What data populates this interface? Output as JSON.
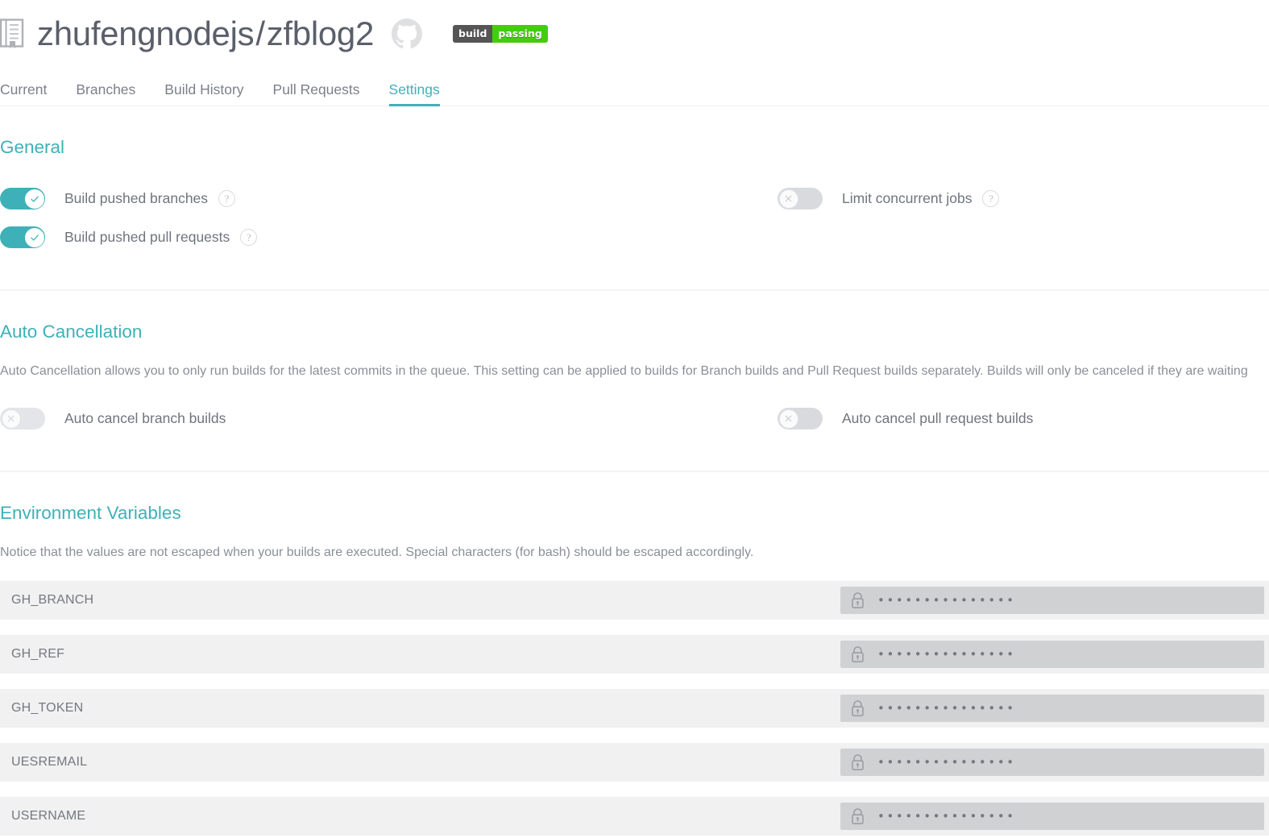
{
  "header": {
    "repo_icon": "book-icon",
    "owner": "zhufengnodejs",
    "separator": "/",
    "repo": "zfblog2",
    "github_icon": "github-icon",
    "badge": {
      "label": "build",
      "status": "passing",
      "label_color": "#555555",
      "status_color": "#44cc11"
    }
  },
  "tabs": [
    {
      "label": "Current",
      "active": false
    },
    {
      "label": "Branches",
      "active": false
    },
    {
      "label": "Build History",
      "active": false
    },
    {
      "label": "Pull Requests",
      "active": false
    },
    {
      "label": "Settings",
      "active": true
    }
  ],
  "accent_color": "#3eb1b8",
  "general": {
    "title": "General",
    "settings": [
      {
        "label": "Build pushed branches",
        "state": "on",
        "help": "?",
        "column": "left"
      },
      {
        "label": "Limit concurrent jobs",
        "state": "off",
        "help": "?",
        "column": "right"
      },
      {
        "label": "Build pushed pull requests",
        "state": "on",
        "help": "?",
        "column": "left"
      }
    ]
  },
  "auto_cancellation": {
    "title": "Auto Cancellation",
    "description": "Auto Cancellation allows you to only run builds for the latest commits in the queue. This setting can be applied to builds for Branch builds and Pull Request builds separately. Builds will only be canceled if they are waiting",
    "settings": [
      {
        "label": "Auto cancel branch builds",
        "state": "off",
        "column": "left"
      },
      {
        "label": "Auto cancel pull request builds",
        "state": "off",
        "column": "right"
      }
    ]
  },
  "environment_variables": {
    "title": "Environment Variables",
    "description": "Notice that the values are not escaped when your builds are executed. Special characters (for bash) should be escaped accordingly.",
    "masked_value": "•••••••••••••••",
    "rows": [
      {
        "name": "GH_BRANCH",
        "value_icon": "lock-icon",
        "value": "•••••••••••••••"
      },
      {
        "name": "GH_REF",
        "value_icon": "lock-icon",
        "value": "•••••••••••••••"
      },
      {
        "name": "GH_TOKEN",
        "value_icon": "lock-icon",
        "value": "•••••••••••••••"
      },
      {
        "name": "UESREMAIL",
        "value_icon": "lock-icon",
        "value": "•••••••••••••••"
      },
      {
        "name": "USERNAME",
        "value_icon": "lock-icon",
        "value": "•••••••••••••••"
      }
    ]
  }
}
